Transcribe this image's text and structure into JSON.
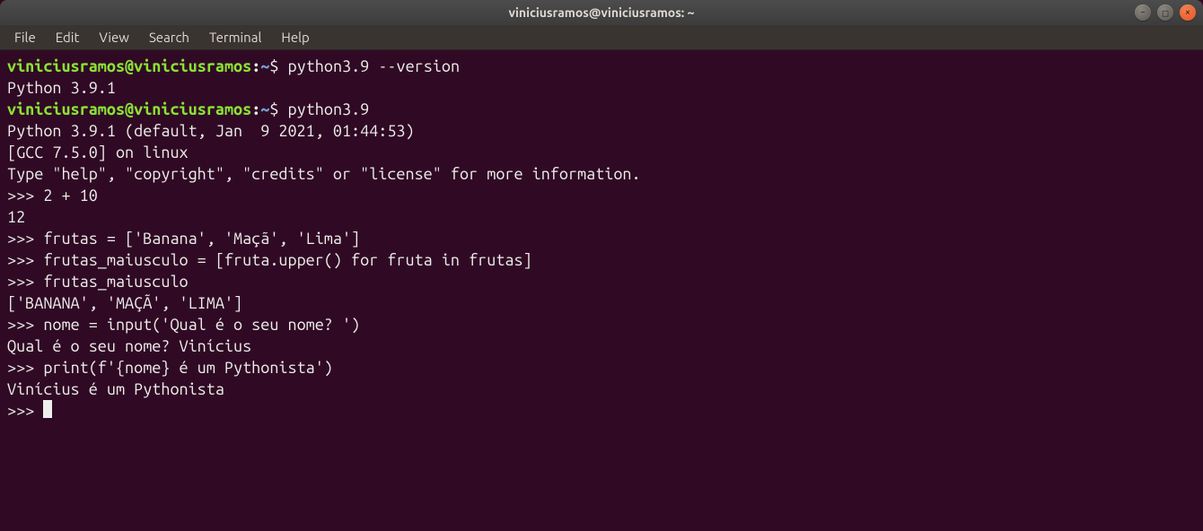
{
  "window": {
    "title": "viniciusramos@viniciusramos: ~",
    "buttons": {
      "minimize": "–",
      "maximize": "□",
      "close": "×"
    }
  },
  "menubar": {
    "items": [
      "File",
      "Edit",
      "View",
      "Search",
      "Terminal",
      "Help"
    ]
  },
  "ps1": {
    "user": "viniciusramos",
    "at": "@",
    "host": "viniciusramos",
    "colon": ":",
    "path": "~",
    "dollar": "$ "
  },
  "repl_prompt": ">>> ",
  "lines": {
    "cmd1": "python3.9 --version",
    "out1": "Python 3.9.1",
    "cmd2": "python3.9",
    "hdr1": "Python 3.9.1 (default, Jan  9 2021, 01:44:53) ",
    "hdr2": "[GCC 7.5.0] on linux",
    "hdr3": "Type \"help\", \"copyright\", \"credits\" or \"license\" for more information.",
    "in1": "2 + 10",
    "r1": "12",
    "in2": "frutas = ['Banana', 'Maçã', 'Lima']",
    "in3": "frutas_maiusculo = [fruta.upper() for fruta in frutas]",
    "in4": "frutas_maiusculo",
    "r4": "['BANANA', 'MAÇÃ', 'LIMA']",
    "in5": "nome = input('Qual é o seu nome? ')",
    "in5r": "Qual é o seu nome? Vinícius",
    "in6": "print(f'{nome} é um Pythonista')",
    "r6": "Vinícius é um Pythonista"
  }
}
